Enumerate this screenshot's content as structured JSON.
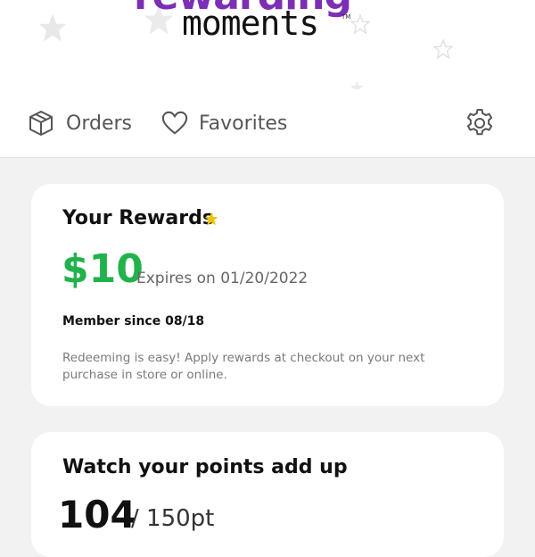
{
  "logo": {
    "top_word": "rewarding",
    "bottom_word": "moments",
    "trademark": "TM"
  },
  "nav": {
    "orders_label": "Orders",
    "favorites_label": "Favorites"
  },
  "rewards": {
    "title": "Your Rewards",
    "amount": "$10",
    "expires": "Expires on 01/20/2022",
    "member_since": "Member since 08/18",
    "description": "Redeeming is easy! Apply rewards at checkout on your next purchase in store or online."
  },
  "points": {
    "title": "Watch your points add up",
    "current": "104",
    "total": "/ 150pt"
  },
  "colors": {
    "reward_green": "#22b24c",
    "star_yellow": "#f2c200"
  }
}
